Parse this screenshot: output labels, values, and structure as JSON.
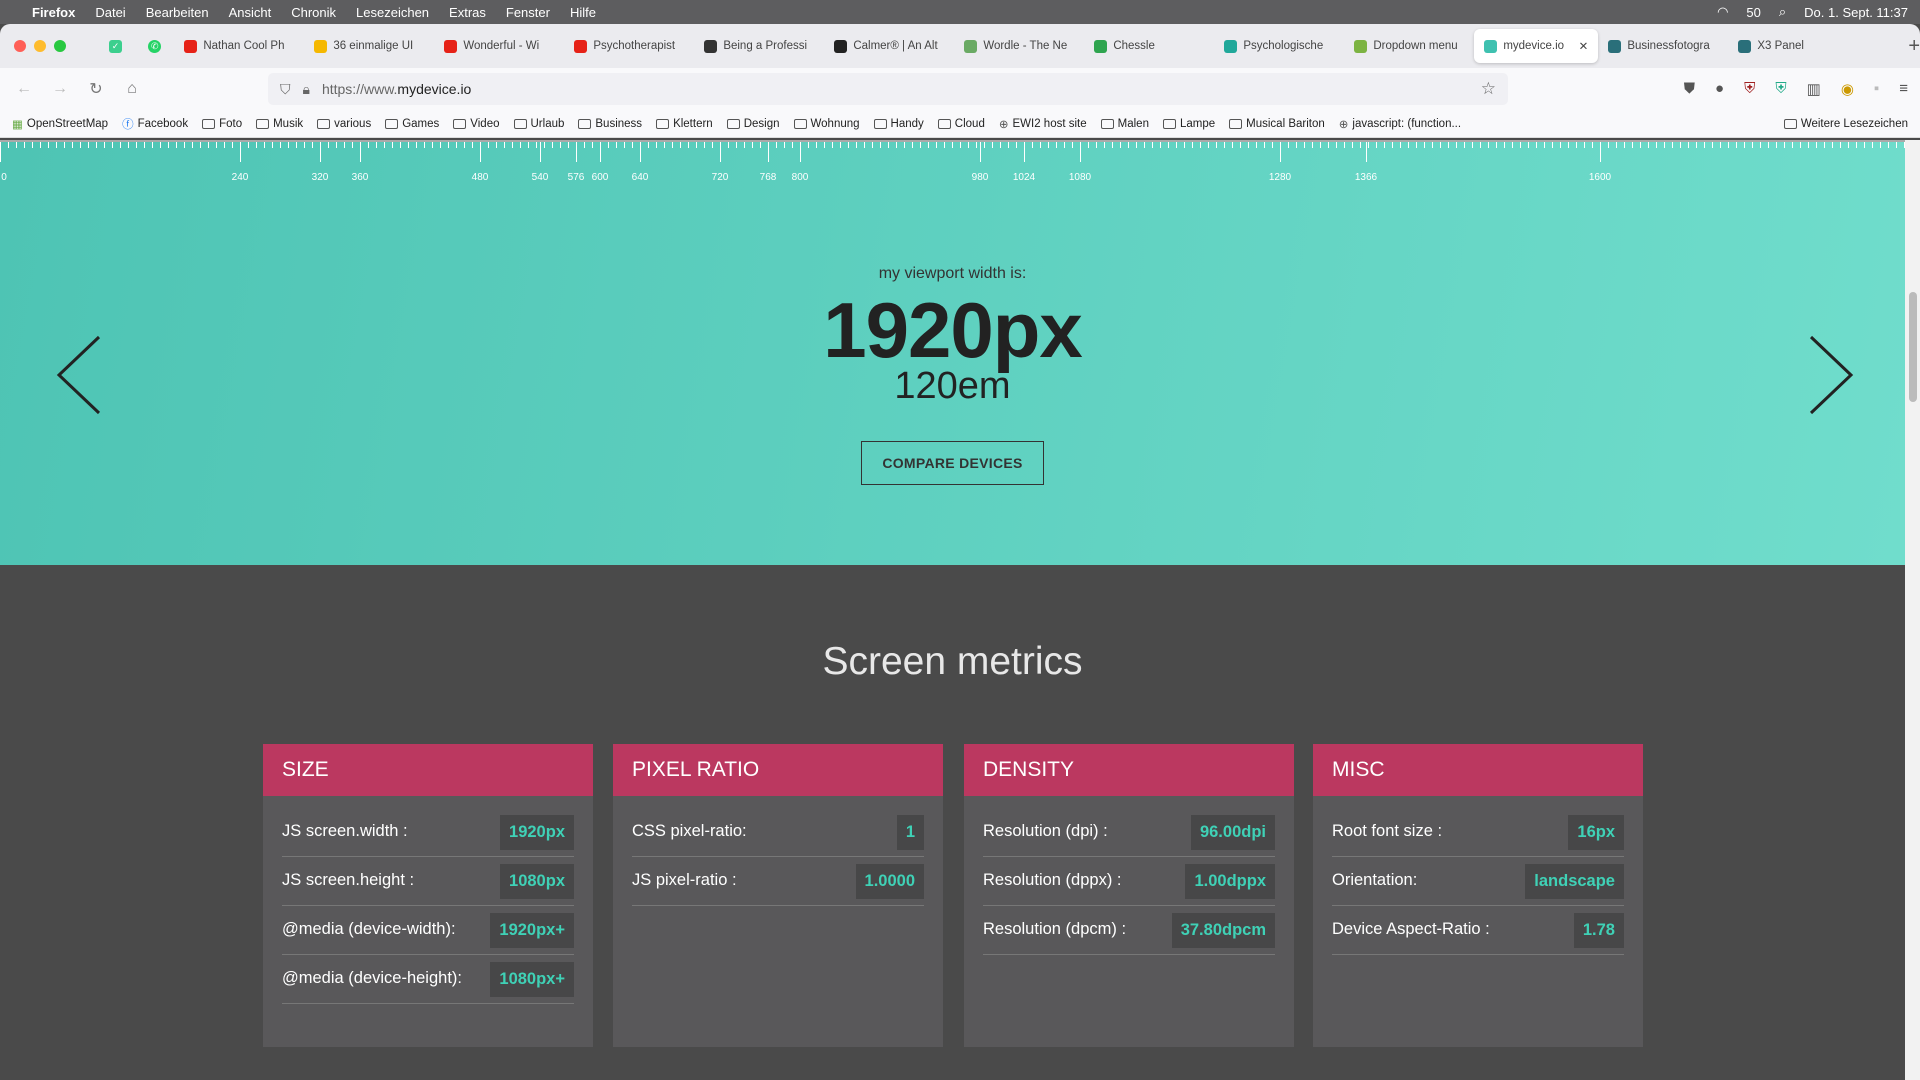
{
  "menubar": {
    "app": "Firefox",
    "items": [
      "Datei",
      "Bearbeiten",
      "Ansicht",
      "Chronik",
      "Lesezeichen",
      "Extras",
      "Fenster",
      "Hilfe"
    ],
    "battery": "50",
    "clock": "Do. 1. Sept.  11:37"
  },
  "tabs": [
    {
      "label": "Nathan Cool Ph",
      "color": "#e62117"
    },
    {
      "label": "36 einmalige UI",
      "color": "#f5b800"
    },
    {
      "label": "Wonderful - Wi",
      "color": "#e62117"
    },
    {
      "label": "Psychotherapist",
      "color": "#e62117"
    },
    {
      "label": "Being a Professi",
      "color": "#333"
    },
    {
      "label": "Calmer® | An Alt",
      "color": "#222"
    },
    {
      "label": "Wordle - The Ne",
      "color": "#6aaa64"
    },
    {
      "label": "Chessle",
      "color": "#2ea44f"
    },
    {
      "label": "Psychologische",
      "color": "#20a89a"
    },
    {
      "label": "Dropdown menu",
      "color": "#7cb342"
    },
    {
      "label": "mydevice.io",
      "color": "#3fc1b0",
      "active": true
    },
    {
      "label": "Businessfotogra",
      "color": "#2a6f7a"
    },
    {
      "label": "X3 Panel",
      "color": "#2a6f7a"
    }
  ],
  "url": {
    "scheme": "https://www.",
    "host": "mydevice.io"
  },
  "bookmarks": [
    "OpenStreetMap",
    "Facebook",
    "Foto",
    "Musik",
    "various",
    "Games",
    "Video",
    "Urlaub",
    "Business",
    "Klettern",
    "Design",
    "Wohnung",
    "Handy",
    "Cloud",
    "EWI2 host site",
    "Malen",
    "Lampe",
    "Musical Bariton",
    "javascript: (function..."
  ],
  "bookmarks_more": "Weitere Lesezeichen",
  "ruler": {
    "labels": [
      "0",
      "240",
      "320",
      "360",
      "480",
      "540",
      "576",
      "600",
      "640",
      "720",
      "768",
      "800",
      "980",
      "1024",
      "1080",
      "1280",
      "1366",
      "1600"
    ]
  },
  "hero": {
    "label": "my viewport width is:",
    "px": "1920px",
    "em": "120em",
    "button": "COMPARE DEVICES"
  },
  "metrics_title": "Screen metrics",
  "colors": {
    "teal": "#4ec4b4",
    "header": "#bb3860",
    "value": "#3fd1b6"
  },
  "cards": [
    {
      "title": "SIZE",
      "rows": [
        {
          "label": "JS screen.width :",
          "value": "1920px"
        },
        {
          "label": "JS screen.height :",
          "value": "1080px"
        },
        {
          "label": "@media (device-width):",
          "value": "1920px+"
        },
        {
          "label": "@media (device-height):",
          "value": "1080px+"
        }
      ]
    },
    {
      "title": "PIXEL RATIO",
      "rows": [
        {
          "label": "CSS pixel-ratio:",
          "value": "1"
        },
        {
          "label": "JS pixel-ratio :",
          "value": "1.0000"
        }
      ]
    },
    {
      "title": "DENSITY",
      "rows": [
        {
          "label": "Resolution (dpi) :",
          "value": "96.00dpi"
        },
        {
          "label": "Resolution (dppx) :",
          "value": "1.00dppx"
        },
        {
          "label": "Resolution (dpcm) :",
          "value": "37.80dpcm"
        }
      ]
    },
    {
      "title": "MISC",
      "rows": [
        {
          "label": "Root font size :",
          "value": "16px"
        },
        {
          "label": "Orientation:",
          "value": "landscape"
        },
        {
          "label": "Device Aspect-Ratio :",
          "value": "1.78"
        }
      ]
    }
  ]
}
